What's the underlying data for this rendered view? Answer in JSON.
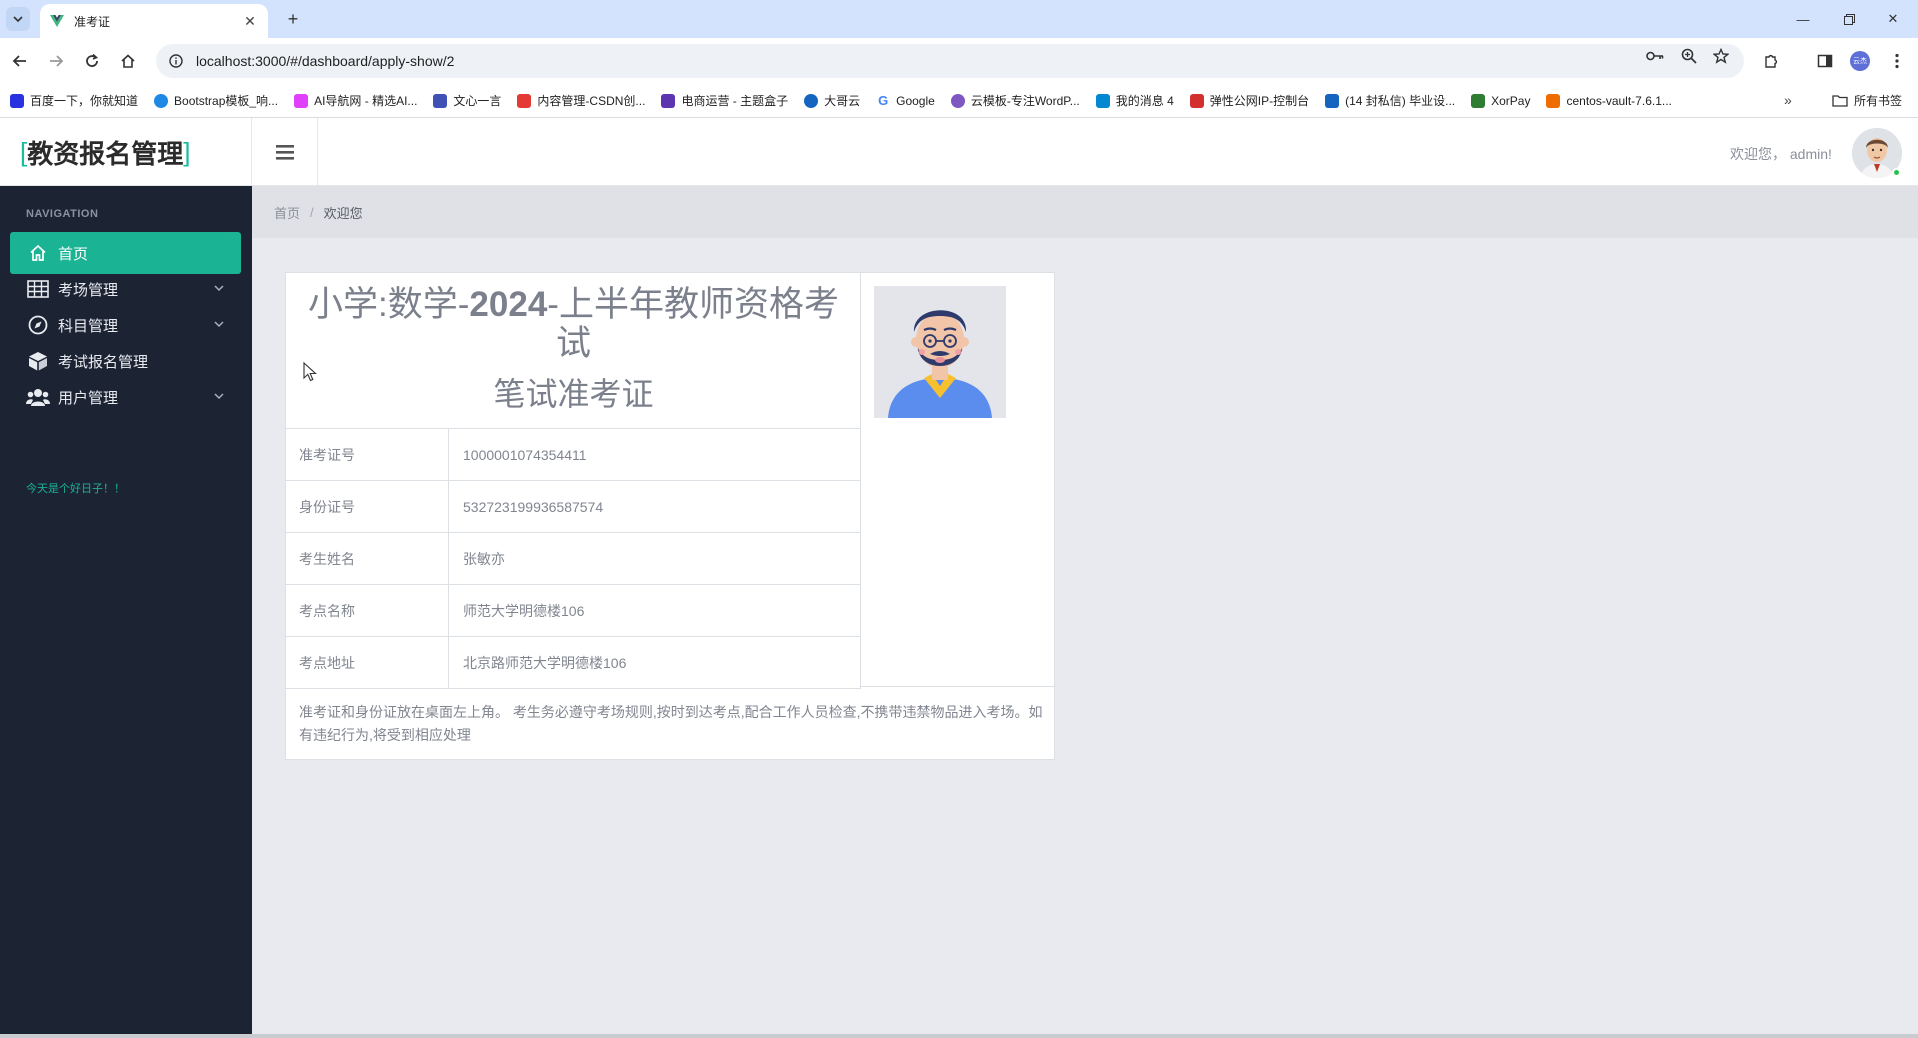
{
  "browser": {
    "tab_title": "准考证",
    "url": "localhost:3000/#/dashboard/apply-show/2",
    "bookmarks": [
      {
        "label": "百度一下，你就知道",
        "color": "#2932e1"
      },
      {
        "label": "Bootstrap模板_响...",
        "color": "#1e88e5"
      },
      {
        "label": "AI导航网 - 精选AI...",
        "color": "#e040fb"
      },
      {
        "label": "文心一言",
        "color": "#3f51b5"
      },
      {
        "label": "内容管理-CSDN创...",
        "color": "#e53935"
      },
      {
        "label": "电商运营 - 主题盒子",
        "color": "#5e35b1"
      },
      {
        "label": "大哥云",
        "color": "#1565c0"
      },
      {
        "label": "Google",
        "color": "#4285f4"
      },
      {
        "label": "云模板-专注WordP...",
        "color": "#7e57c2"
      },
      {
        "label": "我的消息 4",
        "color": "#0288d1"
      },
      {
        "label": "弹性公网IP-控制台",
        "color": "#d32f2f"
      },
      {
        "label": "(14 封私信) 毕业设...",
        "color": "#1565c0"
      },
      {
        "label": "XorPay",
        "color": "#2e7d32"
      },
      {
        "label": "centos-vault-7.6.1...",
        "color": "#ef6c00"
      }
    ],
    "all_bookmarks_label": "所有书签",
    "profile_chip": "云杰"
  },
  "header": {
    "brand_bracket_open": "[",
    "brand": "教资报名管理",
    "brand_bracket_close": "]",
    "welcome": "欢迎您， admin!"
  },
  "sidebar": {
    "nav_label": "NAVIGATION",
    "items": [
      {
        "label": "首页",
        "icon": "home-icon",
        "active": true,
        "expandable": false
      },
      {
        "label": "考场管理",
        "icon": "table-icon",
        "active": false,
        "expandable": true
      },
      {
        "label": "科目管理",
        "icon": "compass-icon",
        "active": false,
        "expandable": true
      },
      {
        "label": "考试报名管理",
        "icon": "cube-icon",
        "active": false,
        "expandable": false
      },
      {
        "label": "用户管理",
        "icon": "users-icon",
        "active": false,
        "expandable": true
      }
    ],
    "note": "今天是个好日子！！"
  },
  "breadcrumb": {
    "home": "首页",
    "separator": "/",
    "current": "欢迎您"
  },
  "ticket": {
    "title_part1": "小学:数学-",
    "title_part2": "2024",
    "title_part3": "-上半年教师资格考试",
    "subtitle": "笔试准考证",
    "rows": [
      {
        "label": "准考证号",
        "value": "1000001074354411"
      },
      {
        "label": "身份证号",
        "value": "532723199936587574"
      },
      {
        "label": "考生姓名",
        "value": "张敏亦"
      },
      {
        "label": "考点名称",
        "value": "师范大学明德楼106"
      },
      {
        "label": "考点地址",
        "value": "北京路师范大学明德楼106"
      }
    ],
    "notice": "准考证和身份证放在桌面左上角。 考生务必遵守考场规则,按时到达考点,配合工作人员检查,不携带违禁物品进入考场。如有违纪行为,将受到相应处理"
  },
  "colors": {
    "sidebar_bg": "#1c2333",
    "accent": "#1ab394",
    "tabstrip": "#d3e3fd"
  }
}
